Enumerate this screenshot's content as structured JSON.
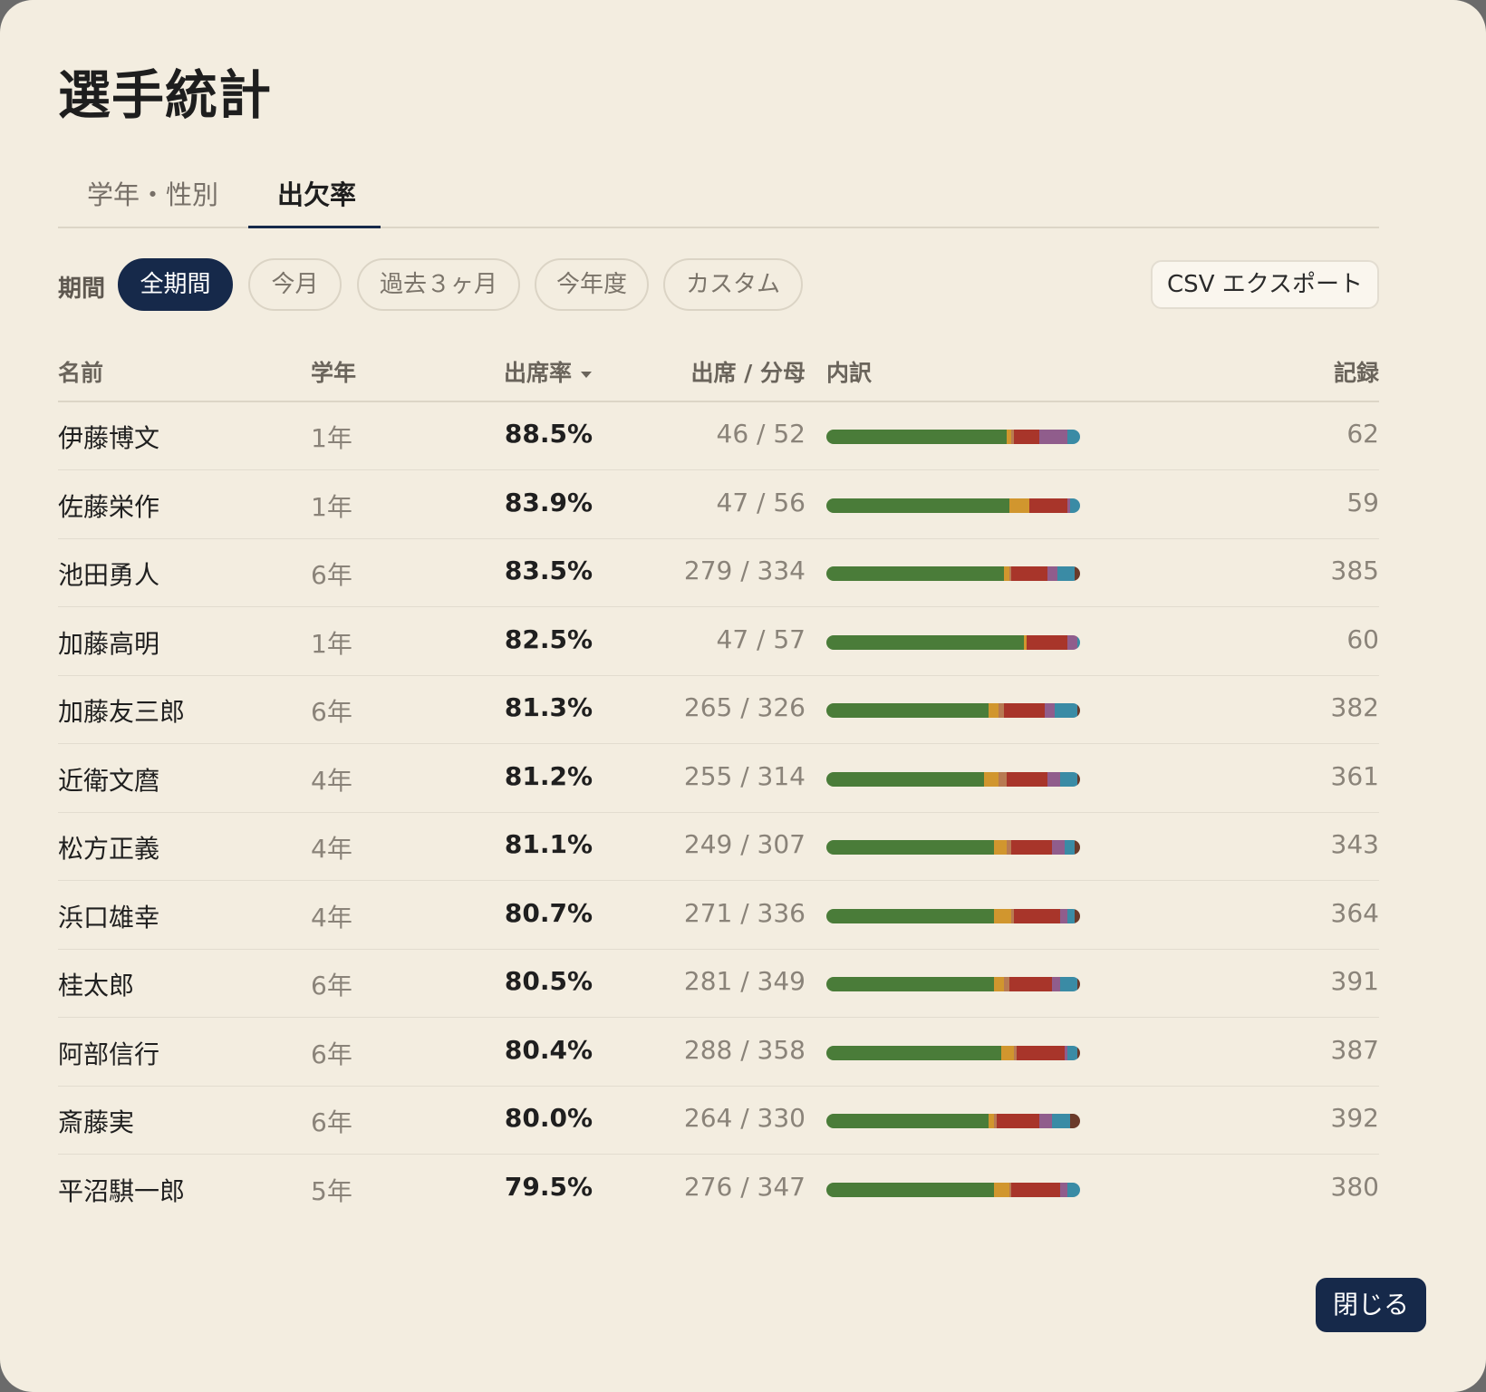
{
  "dialog": {
    "title": "選手統計",
    "close_label": "閉じる"
  },
  "tabs": [
    {
      "label": "学年・性別",
      "active": false
    },
    {
      "label": "出欠率",
      "active": true
    }
  ],
  "filter": {
    "label": "期間",
    "options": [
      "全期間",
      "今月",
      "過去３ヶ月",
      "今年度",
      "カスタム"
    ],
    "selected": "全期間",
    "export_label": "CSV エクスポート"
  },
  "table": {
    "headers": {
      "name": "名前",
      "grade": "学年",
      "rate": "出席率",
      "ratio": "出席 / 分母",
      "breakdown": "内訳",
      "records": "記録"
    },
    "sort": {
      "column": "rate",
      "direction": "desc"
    },
    "colors": [
      "#4a7c39",
      "#d1962e",
      "#b87a52",
      "#a8352a",
      "#905d8c",
      "#3a8ba5",
      "#6b3a2a"
    ],
    "rows": [
      {
        "name": "伊藤博文",
        "grade": "1年",
        "rate": "88.5%",
        "ratio": "46 / 52",
        "records": "62",
        "breakdown": [
          71,
          2,
          1,
          10,
          11,
          5,
          0
        ]
      },
      {
        "name": "佐藤栄作",
        "grade": "1年",
        "rate": "83.9%",
        "ratio": "47 / 56",
        "records": "59",
        "breakdown": [
          72,
          8,
          0,
          15,
          1,
          4,
          0
        ]
      },
      {
        "name": "池田勇人",
        "grade": "6年",
        "rate": "83.5%",
        "ratio": "279 / 334",
        "records": "385",
        "breakdown": [
          70,
          2,
          1,
          14,
          4,
          7,
          2
        ]
      },
      {
        "name": "加藤高明",
        "grade": "1年",
        "rate": "82.5%",
        "ratio": "47 / 57",
        "records": "60",
        "breakdown": [
          78,
          1,
          0,
          16,
          4,
          1,
          0
        ]
      },
      {
        "name": "加藤友三郎",
        "grade": "6年",
        "rate": "81.3%",
        "ratio": "265 / 326",
        "records": "382",
        "breakdown": [
          64,
          4,
          2,
          16,
          4,
          9,
          1
        ]
      },
      {
        "name": "近衛文麿",
        "grade": "4年",
        "rate": "81.2%",
        "ratio": "255 / 314",
        "records": "361",
        "breakdown": [
          62,
          6,
          3,
          16,
          5,
          7,
          1
        ]
      },
      {
        "name": "松方正義",
        "grade": "4年",
        "rate": "81.1%",
        "ratio": "249 / 307",
        "records": "343",
        "breakdown": [
          66,
          5,
          2,
          16,
          5,
          4,
          2
        ]
      },
      {
        "name": "浜口雄幸",
        "grade": "4年",
        "rate": "80.7%",
        "ratio": "271 / 336",
        "records": "364",
        "breakdown": [
          66,
          7,
          1,
          18,
          3,
          3,
          2
        ]
      },
      {
        "name": "桂太郎",
        "grade": "6年",
        "rate": "80.5%",
        "ratio": "281 / 349",
        "records": "391",
        "breakdown": [
          66,
          4,
          2,
          17,
          3,
          7,
          1
        ]
      },
      {
        "name": "阿部信行",
        "grade": "6年",
        "rate": "80.4%",
        "ratio": "288 / 358",
        "records": "387",
        "breakdown": [
          69,
          5,
          1,
          19,
          1,
          4,
          1
        ]
      },
      {
        "name": "斎藤実",
        "grade": "6年",
        "rate": "80.0%",
        "ratio": "264 / 330",
        "records": "392",
        "breakdown": [
          64,
          2,
          1,
          17,
          5,
          7,
          4
        ]
      },
      {
        "name": "平沼騏一郎",
        "grade": "5年",
        "rate": "79.5%",
        "ratio": "276 / 347",
        "records": "380",
        "breakdown": [
          66,
          6,
          1,
          19,
          3,
          5,
          0
        ]
      }
    ]
  }
}
